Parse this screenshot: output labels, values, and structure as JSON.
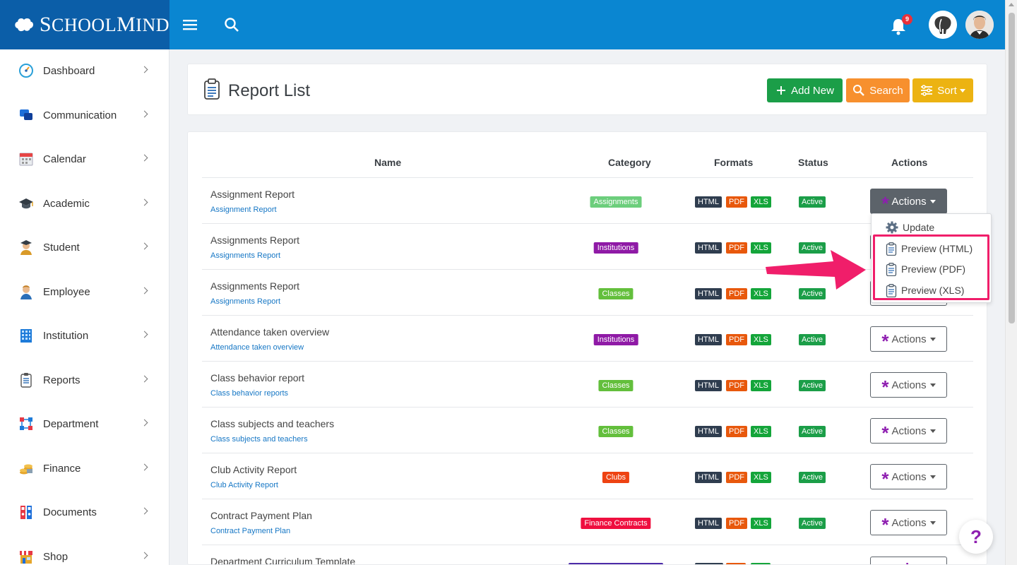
{
  "brand": {
    "name_first": "S",
    "name_rest": "CHOOL",
    "name_second": "M",
    "name_rest2": "IND"
  },
  "topbar": {
    "notification_count": "9"
  },
  "sidebar": {
    "items": [
      {
        "label": "Dashboard",
        "icon": "dashboard-icon"
      },
      {
        "label": "Communication",
        "icon": "communication-icon"
      },
      {
        "label": "Calendar",
        "icon": "calendar-icon"
      },
      {
        "label": "Academic",
        "icon": "graduation-cap-icon"
      },
      {
        "label": "Student",
        "icon": "student-icon"
      },
      {
        "label": "Employee",
        "icon": "employee-icon"
      },
      {
        "label": "Institution",
        "icon": "building-icon"
      },
      {
        "label": "Reports",
        "icon": "clipboard-icon"
      },
      {
        "label": "Department",
        "icon": "department-icon"
      },
      {
        "label": "Finance",
        "icon": "coins-icon"
      },
      {
        "label": "Documents",
        "icon": "binders-icon"
      },
      {
        "label": "Shop",
        "icon": "shop-icon"
      }
    ]
  },
  "header": {
    "title": "Report List",
    "add_label": "Add New",
    "search_label": "Search",
    "sort_label": "Sort"
  },
  "table": {
    "columns": {
      "name": "Name",
      "category": "Category",
      "formats": "Formats",
      "status": "Status",
      "actions": "Actions"
    },
    "formats": {
      "html": "HTML",
      "pdf": "PDF",
      "xls": "XLS"
    },
    "action_label": "Actions",
    "rows": [
      {
        "name": "Assignment Report",
        "sub": "Assignment Report",
        "category": "Assignments",
        "cat_color": "#6cce7c",
        "status": "Active"
      },
      {
        "name": "Assignments Report",
        "sub": "Assignments Report",
        "category": "Institutions",
        "cat_color": "#8f1aa6",
        "status": "Active"
      },
      {
        "name": "Assignments Report",
        "sub": "Assignments Report",
        "category": "Classes",
        "cat_color": "#63bf3c",
        "status": "Active"
      },
      {
        "name": "Attendance taken overview",
        "sub": "Attendance taken overview",
        "category": "Institutions",
        "cat_color": "#8f1aa6",
        "status": "Active"
      },
      {
        "name": "Class behavior report",
        "sub": "Class behavior reports",
        "category": "Classes",
        "cat_color": "#63bf3c",
        "status": "Active"
      },
      {
        "name": "Class subjects and teachers",
        "sub": "Class subjects and teachers",
        "category": "Classes",
        "cat_color": "#63bf3c",
        "status": "Active"
      },
      {
        "name": "Club Activity Report",
        "sub": "Club Activity Report",
        "category": "Clubs",
        "cat_color": "#ee4312",
        "status": "Active"
      },
      {
        "name": "Contract Payment Plan",
        "sub": "Contract Payment Plan",
        "category": "Finance Contracts",
        "cat_color": "#ef0f3f",
        "status": "Active"
      },
      {
        "name": "Department Curriculum Template",
        "sub": "",
        "category": "",
        "cat_color": "#4b2aa8",
        "status": ""
      }
    ]
  },
  "dropdown": {
    "items": [
      {
        "label": "Update"
      },
      {
        "label": "Preview (HTML)"
      },
      {
        "label": "Preview (PDF)"
      },
      {
        "label": "Preview (XLS)"
      }
    ]
  },
  "help_label": "?",
  "colors": {
    "topbar": "#0a86d1",
    "brand_bg": "#0b5ea8",
    "highlight": "#f01e6a",
    "accent": "#8e1eb0"
  }
}
